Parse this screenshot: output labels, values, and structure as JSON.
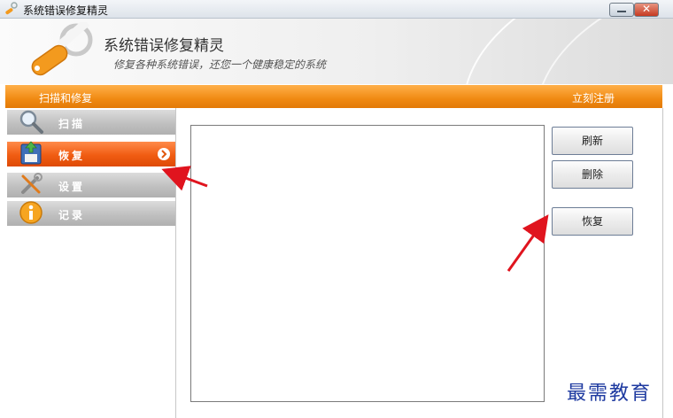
{
  "window": {
    "title": "系统错误修复精灵"
  },
  "banner": {
    "app_name": "系统错误修复精灵",
    "slogan": "修复各种系统错误，还您一个健康稳定的系统"
  },
  "header_bar": {
    "section_title": "扫描和修复",
    "register_link": "立刻注册"
  },
  "sidebar": {
    "items": [
      {
        "label": "扫描",
        "icon": "magnifier-icon",
        "active": false
      },
      {
        "label": "恢复",
        "icon": "restore-disk-icon",
        "active": true
      },
      {
        "label": "设置",
        "icon": "tools-icon",
        "active": false
      },
      {
        "label": "记录",
        "icon": "info-icon",
        "active": false
      }
    ]
  },
  "actions": {
    "refresh": "刷新",
    "delete": "删除",
    "restore": "恢复"
  },
  "colors": {
    "accent_orange": "#f08a12",
    "active_item": "#f05c12",
    "annotation_arrow": "#e0141e"
  },
  "watermark": "最需教育"
}
